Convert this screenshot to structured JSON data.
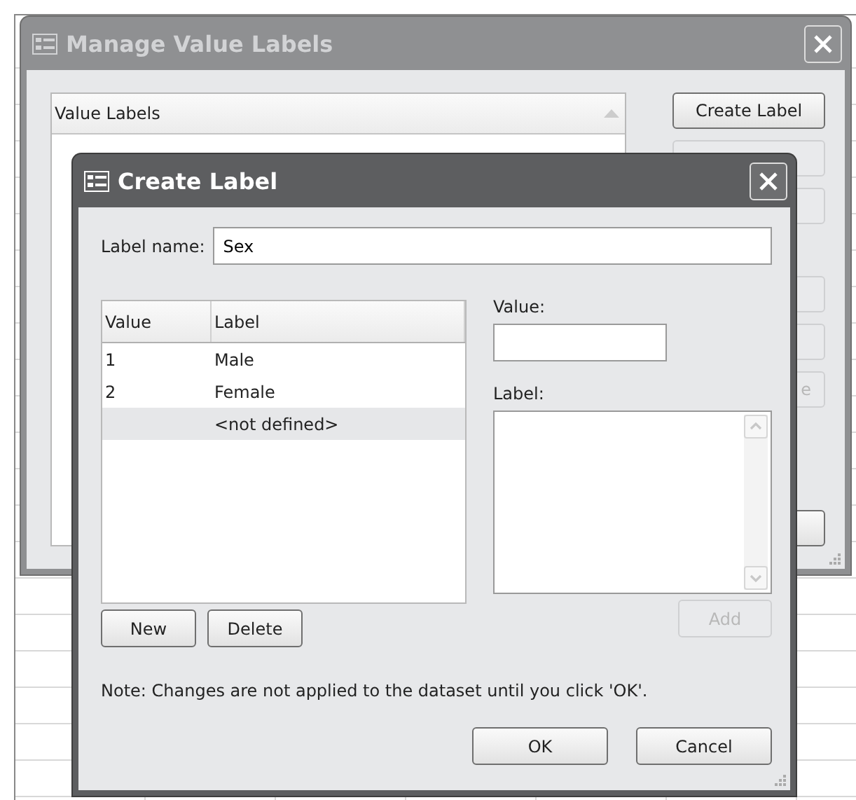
{
  "manage_window": {
    "title": "Manage Value Labels",
    "active": false,
    "list": {
      "header": "Value Labels"
    },
    "button_groups": [
      [
        {
          "label": "Create Label",
          "disabled": false
        },
        {
          "disabled": true
        },
        {
          "disabled": true
        }
      ],
      [
        {
          "disabled": true
        },
        {
          "disabled": true
        },
        {
          "label": "e",
          "disabled": true
        }
      ],
      [
        {
          "disabled": false
        }
      ]
    ]
  },
  "create_dialog": {
    "title": "Create Label",
    "active": true,
    "label_name": {
      "label": "Label name:",
      "value": "Sex"
    },
    "table": {
      "columns": [
        "Value",
        "Label"
      ],
      "rows": [
        {
          "value": "1",
          "label": "Male",
          "selected": false
        },
        {
          "value": "2",
          "label": "Female",
          "selected": false
        },
        {
          "label": "<not defined>",
          "selected": true
        }
      ]
    },
    "value_field": {
      "label": "Value:"
    },
    "label_field": {
      "label": "Label:"
    },
    "list_buttons": [
      {
        "label": "New",
        "disabled": false
      },
      {
        "label": "Delete",
        "disabled": false
      }
    ],
    "add_button": {
      "label": "Add",
      "disabled": true
    },
    "note": "Note: Changes are not applied to the dataset until you click 'OK'.",
    "buttons": [
      {
        "label": "OK",
        "disabled": false
      },
      {
        "label": "Cancel",
        "disabled": false
      }
    ]
  }
}
